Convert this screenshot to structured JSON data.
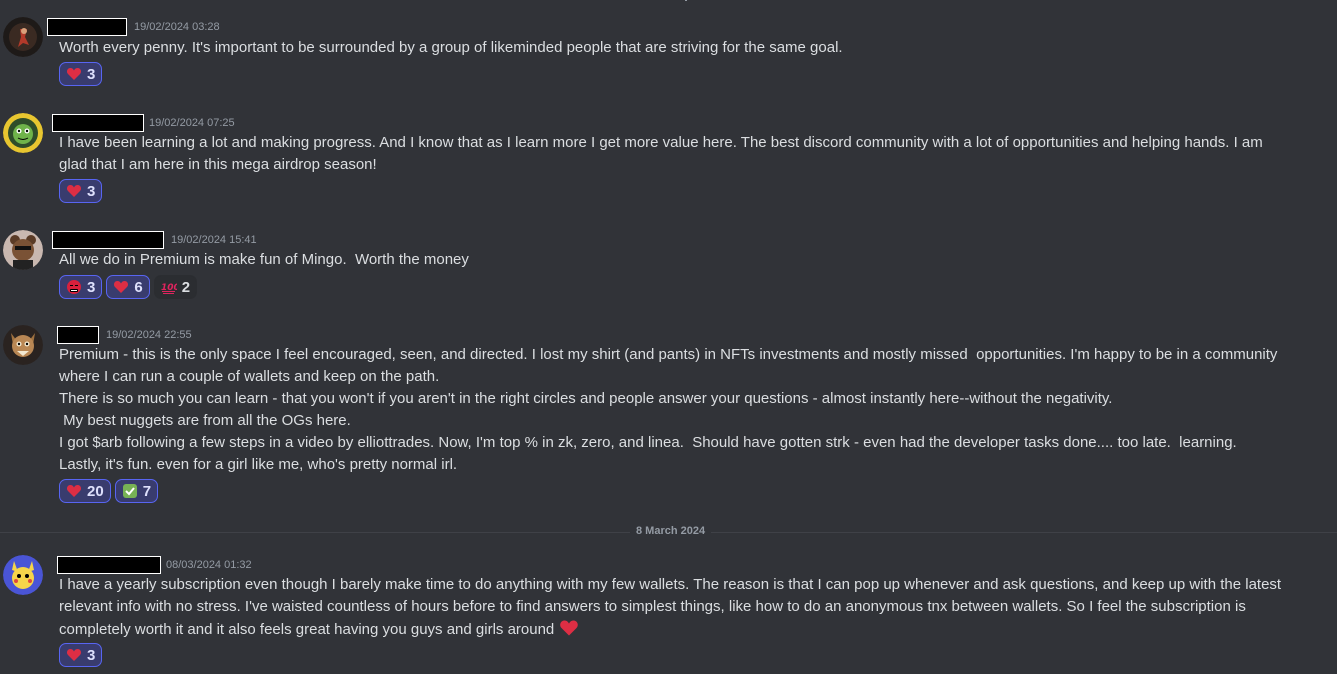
{
  "date_divider": "8 March 2024",
  "messages": [
    {
      "timestamp": "19/02/2024 03:28",
      "text": "Worth every penny. It's important to be surrounded by a group of likeminded people that are striving for the same goal.",
      "reactions": [
        {
          "emoji": "heart-emoji",
          "count": "3"
        }
      ]
    },
    {
      "timestamp": "19/02/2024 07:25",
      "text": "I have been learning a lot and making progress. And I know that as I learn more I get more value here. The best discord community with a lot of opportunities and helping hands. I am\nglad that I am here in this mega airdrop season!",
      "reactions": [
        {
          "emoji": "heart-emoji",
          "count": "3"
        }
      ]
    },
    {
      "timestamp": "19/02/2024 15:41",
      "text": "All we do in Premium is make fun of Mingo.  Worth the money",
      "reactions": [
        {
          "emoji": "angry-face-emoji",
          "count": "3"
        },
        {
          "emoji": "heart-emoji",
          "count": "6"
        },
        {
          "emoji": "hundred-points-emoji",
          "count": "2"
        }
      ]
    },
    {
      "timestamp": "19/02/2024 22:55",
      "text": "Premium - this is the only space I feel encouraged, seen, and directed. I lost my shirt (and pants) in NFTs investments and mostly missed  opportunities. I'm happy to be in a community\nwhere I can run a couple of wallets and keep on the path.\nThere is so much you can learn - that you won't if you aren't in the right circles and people answer your questions - almost instantly here--without the negativity.\n My best nuggets are from all the OGs here.\nI got $arb following a few steps in a video by elliottrades. Now, I'm top % in zk, zero, and linea.  Should have gotten strk - even had the developer tasks done.... too late.  learning.\nLastly, it's fun. even for a girl like me, who's pretty normal irl.",
      "reactions": [
        {
          "emoji": "heart-emoji",
          "count": "20"
        },
        {
          "emoji": "check-mark-emoji",
          "count": "7"
        }
      ]
    },
    {
      "timestamp": "08/03/2024 01:32",
      "text": "I have a yearly subscription even though I barely make time to do anything with my few wallets. The reason is that I can pop up whenever and ask questions, and keep up with the latest\nrelevant info with no stress. I've waisted countless of hours before to find answers to simplest things, like how to do an anonymous tnx between wallets. So I feel the subscription is\ncompletely worth it and it also feels great having you guys and girls around",
      "reactions": [
        {
          "emoji": "heart-emoji",
          "count": "3"
        }
      ]
    }
  ]
}
